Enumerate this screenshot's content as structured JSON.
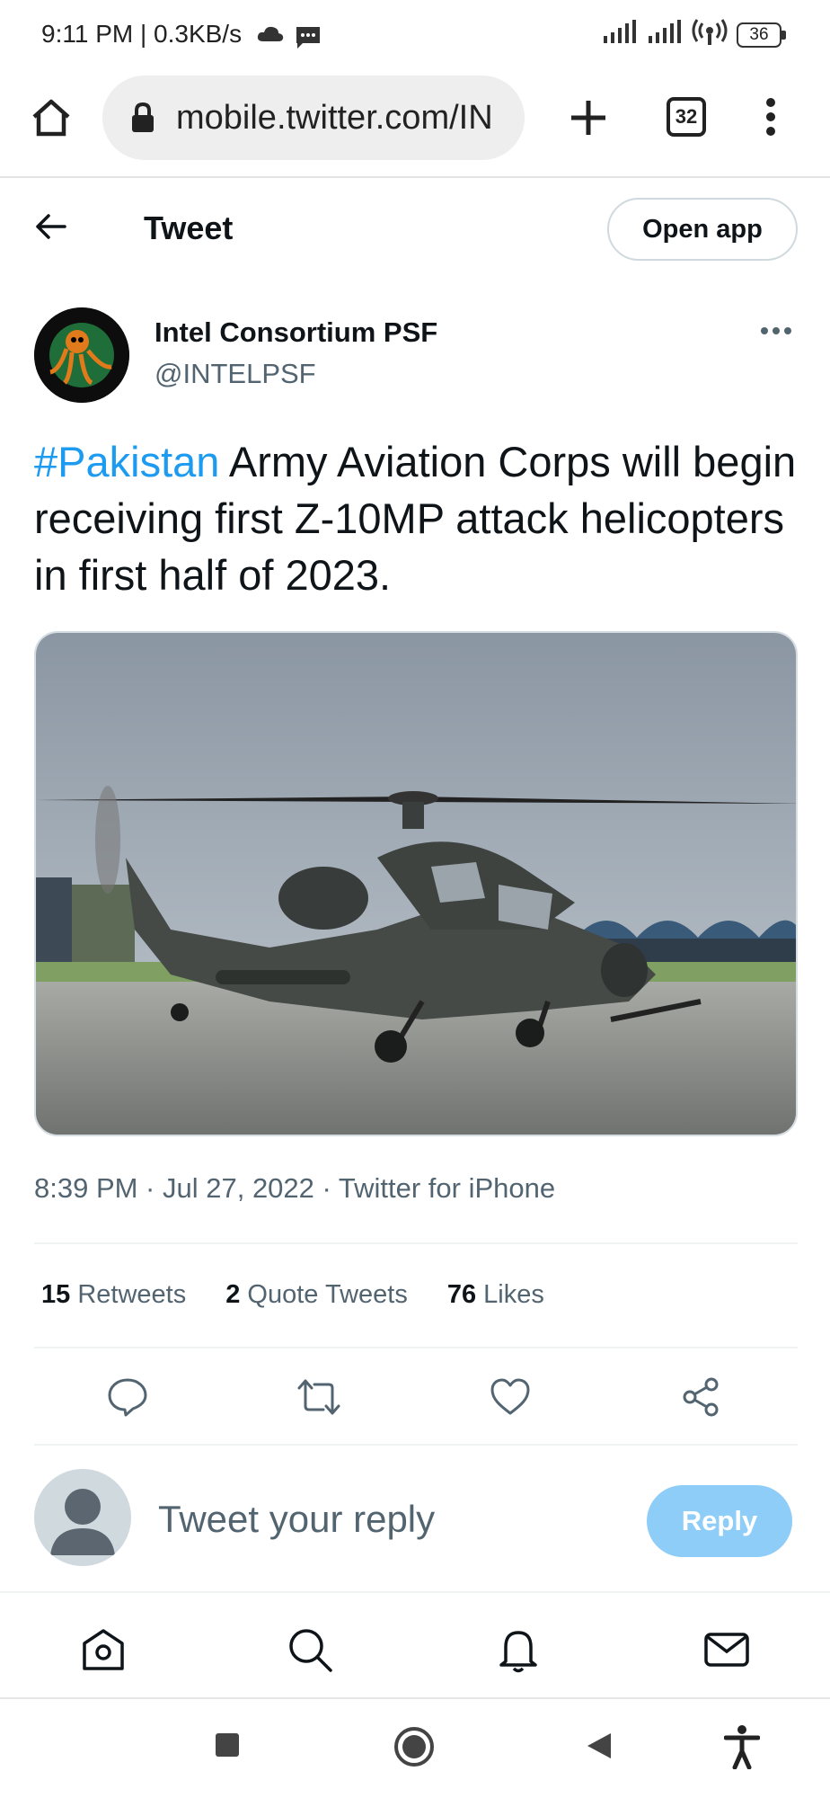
{
  "status_bar": {
    "time_speed": "9:11 PM | 0.3KB/s",
    "battery": "36",
    "icons": [
      "cloud-icon",
      "message-icon",
      "signal-icon",
      "signal-icon",
      "hotspot-icon",
      "battery-icon"
    ]
  },
  "browser": {
    "url": "mobile.twitter.com/IN",
    "tab_count": "32",
    "icons": [
      "home-icon",
      "lock-icon",
      "new-tab-icon",
      "tabs-icon",
      "menu-icon"
    ]
  },
  "header": {
    "title": "Tweet",
    "open_app": "Open app"
  },
  "tweet": {
    "author_name": "Intel Consortium PSF",
    "author_handle": "@INTELPSF",
    "hashtag": "#Pakistan",
    "text": " Army Aviation Corps will begin receiving first Z-10MP attack helicopters in first half of 2023.",
    "meta": "8:39 PM · Jul 27, 2022 · Twitter for iPhone",
    "media_alt": "Z-10MP attack helicopter on tarmac"
  },
  "stats": {
    "retweets_count": "15",
    "retweets_label": "Retweets",
    "quotes_count": "2",
    "quotes_label": "Quote Tweets",
    "likes_count": "76",
    "likes_label": "Likes"
  },
  "reply": {
    "placeholder": "Tweet your reply",
    "button": "Reply"
  },
  "colors": {
    "accent": "#1d9bf0",
    "reply_button": "#8ecdf8",
    "muted": "#536471"
  }
}
